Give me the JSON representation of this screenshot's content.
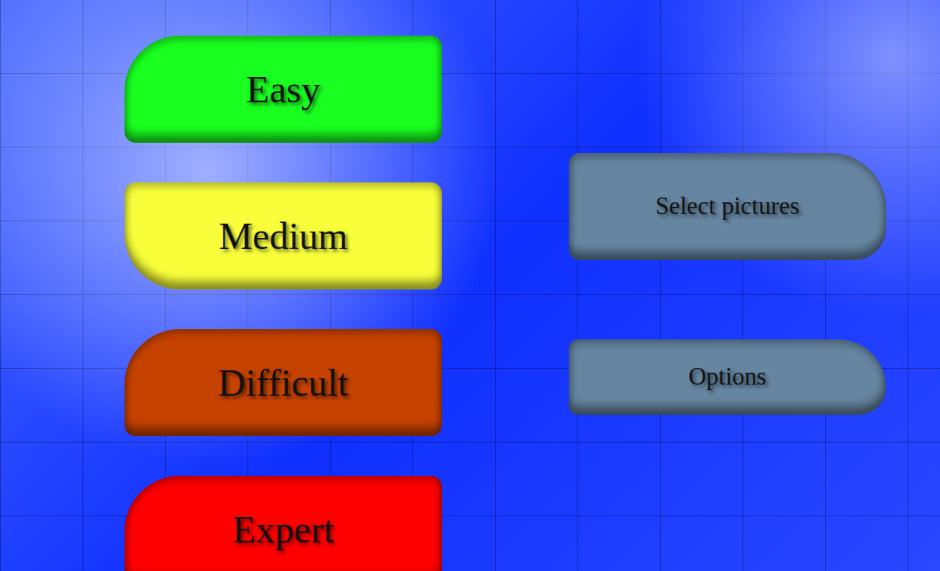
{
  "difficulty_buttons": [
    {
      "label": "Easy",
      "color": "#19ff1f",
      "kind": "top-left"
    },
    {
      "label": "Medium",
      "color": "#f8ff3a",
      "kind": "bottom-left"
    },
    {
      "label": "Difficult",
      "color": "#c64200",
      "kind": "top-left"
    },
    {
      "label": "Expert",
      "color": "#ff0000",
      "kind": "top-left"
    }
  ],
  "menu_buttons": [
    {
      "label": "Select pictures",
      "color": "#6585a0",
      "kind": "top-right"
    },
    {
      "label": "Options",
      "color": "#6585a0",
      "kind": "top-right"
    }
  ]
}
